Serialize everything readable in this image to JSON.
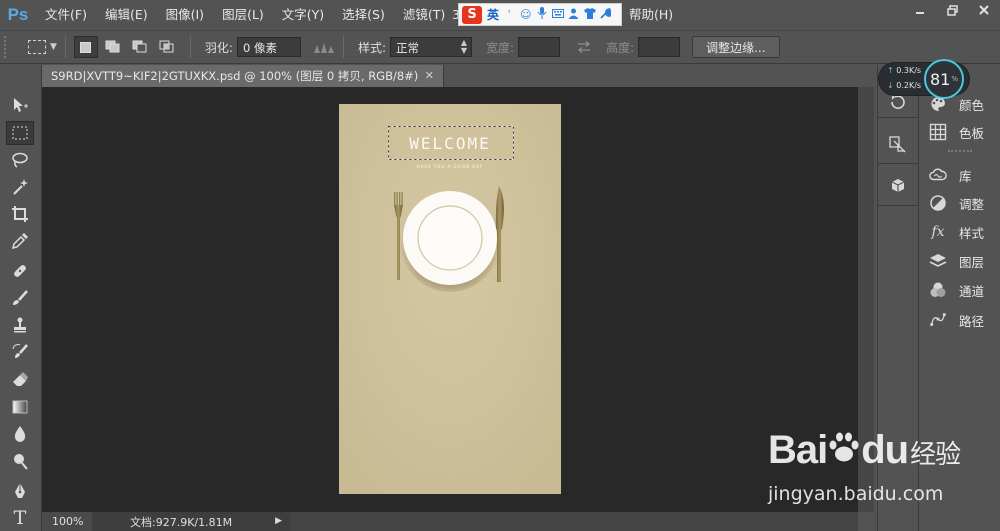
{
  "app": {
    "logo": "Ps",
    "menu": [
      "文件(F)",
      "编辑(E)",
      "图像(I)",
      "图层(L)",
      "文字(Y)",
      "选择(S)",
      "滤镜(T)"
    ],
    "menu_prefix": "3",
    "menu_help": "帮助(H)",
    "window_controls": [
      "minimize-icon",
      "restore-icon",
      "close-icon"
    ]
  },
  "ime": {
    "logo": "S",
    "language": "英",
    "icons": [
      "punctuation-icon",
      "emoji-icon",
      "microphone-icon",
      "keyboard-icon",
      "user-icon",
      "shirt-icon",
      "wrench-icon"
    ]
  },
  "options_bar": {
    "feather_label": "羽化:",
    "feather_value": "0 像素",
    "style_label": "样式:",
    "style_value": "正常",
    "width_label": "宽度:",
    "height_label": "高度:",
    "refine_edge_button": "调整边缘..."
  },
  "document": {
    "tab_title": "S9RD|XVTT9~KIF2|2GTUXKX.psd @ 100% (图层 0 拷贝, RGB/8#)",
    "zoom": "100%",
    "doc_size": "文档:927.9K/1.81M",
    "artboard_color": "#cdbf99"
  },
  "artwork": {
    "welcome": "WELCOME",
    "tagline": "HAVE YOU A GOOD DAY"
  },
  "tools": [
    "move-tool",
    "rectangular-marquee-tool",
    "lasso-tool",
    "magic-wand-tool",
    "crop-tool",
    "eyedropper-tool",
    "healing-brush-tool",
    "brush-tool",
    "clone-stamp-tool",
    "history-brush-tool",
    "eraser-tool",
    "gradient-tool",
    "blur-tool",
    "dodge-tool",
    "pen-tool",
    "type-tool"
  ],
  "panels": [
    {
      "label": "颜色",
      "icon": "palette-icon"
    },
    {
      "label": "色板",
      "icon": "swatches-icon"
    },
    {
      "label": "库",
      "icon": "cloud-icon"
    },
    {
      "label": "调整",
      "icon": "adjustments-icon"
    },
    {
      "label": "样式",
      "icon": "fx-icon"
    },
    {
      "label": "图层",
      "icon": "layers-icon"
    },
    {
      "label": "通道",
      "icon": "channels-icon"
    },
    {
      "label": "路径",
      "icon": "paths-icon"
    }
  ],
  "net_widget": {
    "upload": "0.3K/s",
    "download": "0.2K/s",
    "cpu": "81",
    "cpu_unit": "%"
  },
  "watermark": {
    "logo_text": "Bai",
    "logo_suffix": "du",
    "logo_cn": "经验",
    "url": "jingyan.baidu.com"
  }
}
